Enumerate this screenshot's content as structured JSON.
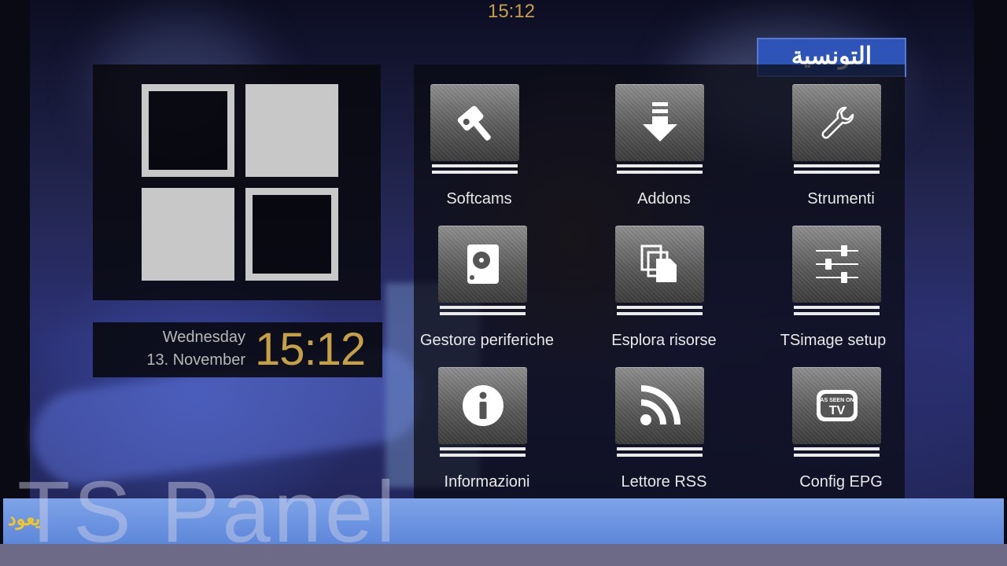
{
  "top_clock": "15:12",
  "channel_logo": "التونسية",
  "datetime": {
    "weekday": "Wednesday",
    "date": "13. November",
    "time": "15:12"
  },
  "menu": {
    "items": [
      {
        "label": "Softcams",
        "icon": "hammer-icon"
      },
      {
        "label": "Addons",
        "icon": "download-arrow-icon"
      },
      {
        "label": "Strumenti",
        "icon": "wrench-icon"
      },
      {
        "label": "Gestore periferiche",
        "icon": "hard-disk-icon"
      },
      {
        "label": "Esplora risorse",
        "icon": "files-icon"
      },
      {
        "label": "TSimage setup",
        "icon": "sliders-icon"
      },
      {
        "label": "Informazioni",
        "icon": "info-icon"
      },
      {
        "label": "Lettore RSS",
        "icon": "rss-icon"
      },
      {
        "label": "Config EPG",
        "icon": "as-seen-on-tv-icon"
      }
    ]
  },
  "tv_badge": {
    "line1": "AS SEEN ON",
    "line2": "TV"
  },
  "ticker_text": "يعود",
  "watermark": "TS Panel",
  "colors": {
    "accent": "#c6a046",
    "tile_line": "#eaeaea",
    "ticker_bar": "#7ea3e8"
  }
}
